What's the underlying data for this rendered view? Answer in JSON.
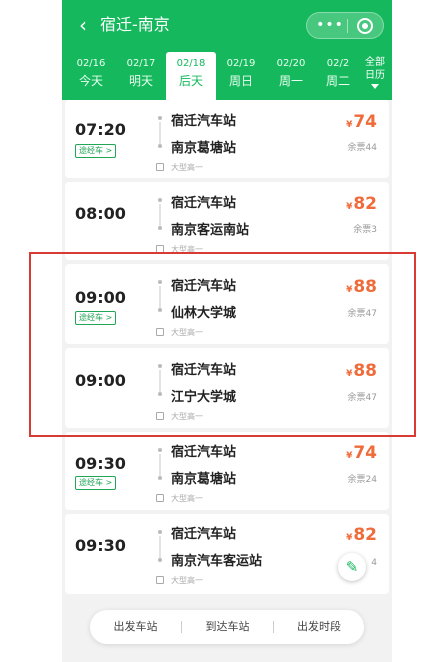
{
  "header": {
    "title": "宿迁-南京",
    "back_icon": "chevron-left-icon",
    "more_icon": "more-dots-icon",
    "close_icon": "target-close-icon",
    "more_label": "•••"
  },
  "dates": [
    {
      "date": "02/16",
      "weekday": "今天"
    },
    {
      "date": "02/17",
      "weekday": "明天"
    },
    {
      "date": "02/18",
      "weekday": "后天",
      "active": true
    },
    {
      "date": "02/19",
      "weekday": "周日"
    },
    {
      "date": "02/20",
      "weekday": "周一"
    },
    {
      "date": "02/2",
      "weekday": "周二"
    }
  ],
  "all_dates": {
    "line1": "全部",
    "line2": "日历"
  },
  "trips": [
    {
      "time": "07:20",
      "tag": "途经车 >",
      "from": "宿迁汽车站",
      "to": "南京葛塘站",
      "bus_type": "大型高一",
      "currency": "¥",
      "price": "74",
      "remaining": "余票44"
    },
    {
      "time": "08:00",
      "tag": "",
      "from": "宿迁汽车站",
      "to": "南京客运南站",
      "bus_type": "大型高一",
      "currency": "¥",
      "price": "82",
      "remaining": "余票3"
    },
    {
      "time": "09:00",
      "tag": "途经车 >",
      "from": "宿迁汽车站",
      "to": "仙林大学城",
      "bus_type": "大型高一",
      "currency": "¥",
      "price": "88",
      "remaining": "余票47"
    },
    {
      "time": "09:00",
      "tag": "",
      "from": "宿迁汽车站",
      "to": "江宁大学城",
      "bus_type": "大型高一",
      "currency": "¥",
      "price": "88",
      "remaining": "余票47"
    },
    {
      "time": "09:30",
      "tag": "途经车 >",
      "from": "宿迁汽车站",
      "to": "南京葛塘站",
      "bus_type": "大型高一",
      "currency": "¥",
      "price": "74",
      "remaining": "余票24"
    },
    {
      "time": "09:30",
      "tag": "",
      "from": "宿迁汽车站",
      "to": "南京汽车客运站",
      "bus_type": "大型高一",
      "currency": "¥",
      "price": "82",
      "remaining": "4"
    }
  ],
  "float_icon": "edit-icon",
  "float_glyph": "✎",
  "filters": [
    "出发车站",
    "到达车站",
    "出发时段"
  ],
  "colors": {
    "brand": "#15b85c",
    "price": "#ef6b3a",
    "highlight": "#d83a34"
  }
}
